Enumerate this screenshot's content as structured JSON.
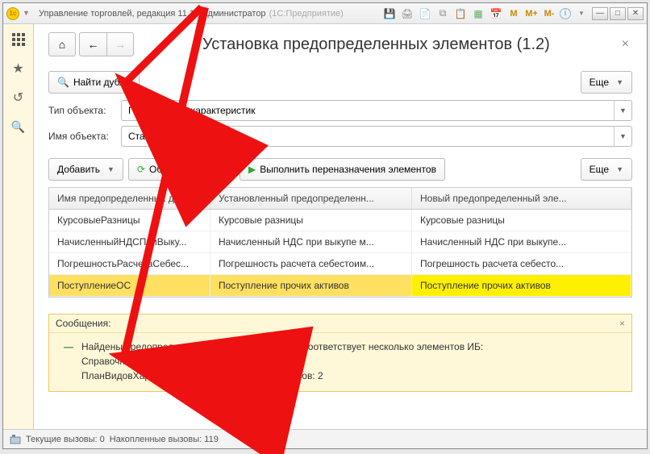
{
  "titlebar": {
    "title": "Управление торговлей, редакция 11.1 / Администратор",
    "app": "(1С:Предприятие)",
    "m_labels": [
      "M",
      "M+",
      "M-"
    ]
  },
  "page": {
    "title": "Установка предопределенных элементов (1.2)"
  },
  "buttons": {
    "find_duplicates": "Найти дубли",
    "more": "Еще",
    "add": "Добавить",
    "refresh_list": "Обновить список",
    "execute_reassign": "Выполнить переназначения элементов"
  },
  "form": {
    "type_label": "Тип объекта:",
    "type_value": "Планы видов характеристик",
    "name_label": "Имя объекта:",
    "name_value": "СтатьиРасходов"
  },
  "table": {
    "headers": [
      "Имя предопределенных д...",
      "Установленный предопределенн...",
      "Новый предопределенный эле..."
    ],
    "rows": [
      {
        "c0": "КурсовыеРазницы",
        "c1": "Курсовые разницы",
        "c2": "Курсовые разницы",
        "sel": false
      },
      {
        "c0": "НачисленныйНДСПриВыку...",
        "c1": "Начисленный НДС при выкупе м...",
        "c2": "Начисленный НДС при выкупе...",
        "sel": false
      },
      {
        "c0": "ПогрешностьРасчетаСебес...",
        "c1": "Погрешность расчета себестоим...",
        "c2": "Погрешность расчета себесто...",
        "sel": false
      },
      {
        "c0": "ПоступлениеОС",
        "c1": "Поступление прочих активов",
        "c2": "Поступление прочих активов",
        "sel": true
      }
    ]
  },
  "messages": {
    "header": "Сообщения:",
    "lines": [
      "Найдены предопределенные значения, которым соответствует несколько элементов ИБ:",
      "Справочник.ВидыКонтактнойИнформации: 1",
      "ПланВидовХарактеристик.СтатьиАктивовПассивов: 2"
    ]
  },
  "status": {
    "current": "Текущие вызовы: 0",
    "accum": "Накопленные вызовы: 119"
  }
}
